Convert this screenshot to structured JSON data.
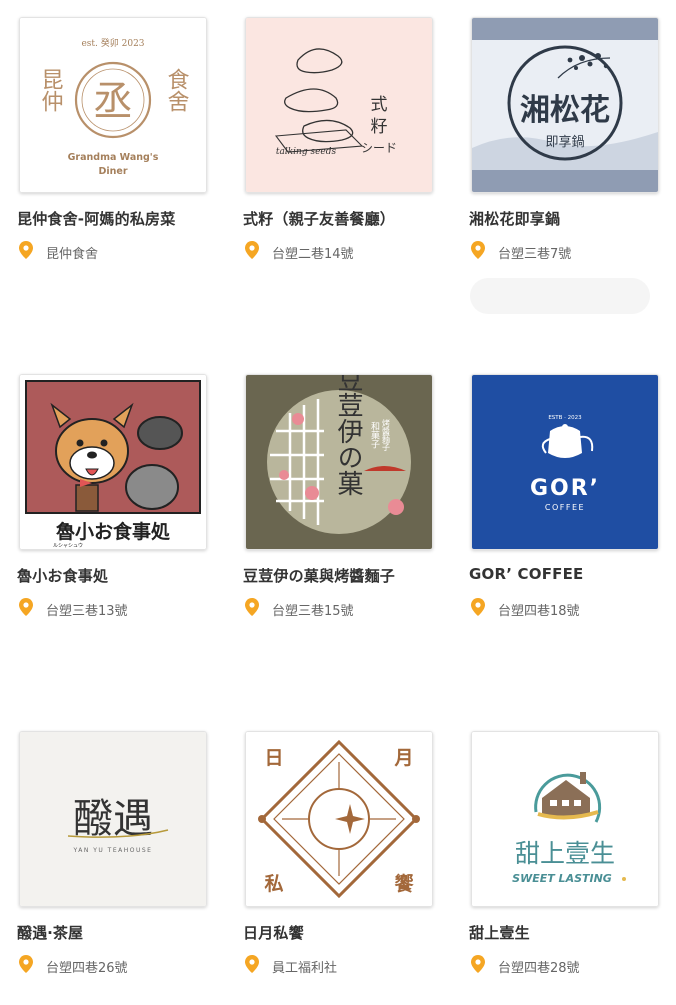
{
  "restaurants": [
    {
      "name": "昆仲食舍-阿媽的私房菜",
      "address": "昆仲食舍",
      "logo": {
        "est": "est. 癸卯 2023",
        "left": "昆仲",
        "right": "食舍",
        "line1": "Grandma Wang's",
        "line2": "Diner",
        "seal": "丞"
      }
    },
    {
      "name": "式籽（親子友善餐廳）",
      "address": "台塑二巷14號",
      "logo": {
        "script": "talking seeds",
        "col1": "式",
        "col2": "籽",
        "kana": "シード"
      }
    },
    {
      "name": "湘松花即享鍋",
      "address": "台塑三巷7號",
      "logo": {
        "main": "湘松花",
        "sub": "即享鍋"
      }
    },
    {
      "name": "魯小お食事処",
      "address": "台塑三巷13號",
      "logo": {
        "main": "魯小お食事処",
        "kana": "ルシャシュウ"
      }
    },
    {
      "name": "豆荳伊の菓與烤醬麵子",
      "address": "台塑三巷15號",
      "logo": {
        "main": "豆荳伊の菓",
        "sub1": "和菓子",
        "sub2": "烤醬麵子"
      }
    },
    {
      "name": "GOR’ COFFEE",
      "address": "台塑四巷18號",
      "logo": {
        "est": "ESTB · 2023",
        "main": "GOR’",
        "sub": "COFFEE"
      }
    },
    {
      "name": "醱遇‧茶屋",
      "address": "台塑四巷26號",
      "logo": {
        "main": "醱遇",
        "sub": "YAN YU TEAHOUSE"
      }
    },
    {
      "name": "日月私饗",
      "address": "員工福利社",
      "logo": {
        "c1": "日",
        "c2": "月",
        "c3": "私",
        "c4": "饗"
      }
    },
    {
      "name": "甜上壹生",
      "address": "台塑四巷28號",
      "logo": {
        "main": "甜上壹生",
        "sub": "SWEET LASTING"
      }
    }
  ],
  "icons": {
    "pin": "map-pin-icon"
  },
  "colors": {
    "pin": "#f5a623",
    "title": "#333333",
    "address": "#666666"
  }
}
